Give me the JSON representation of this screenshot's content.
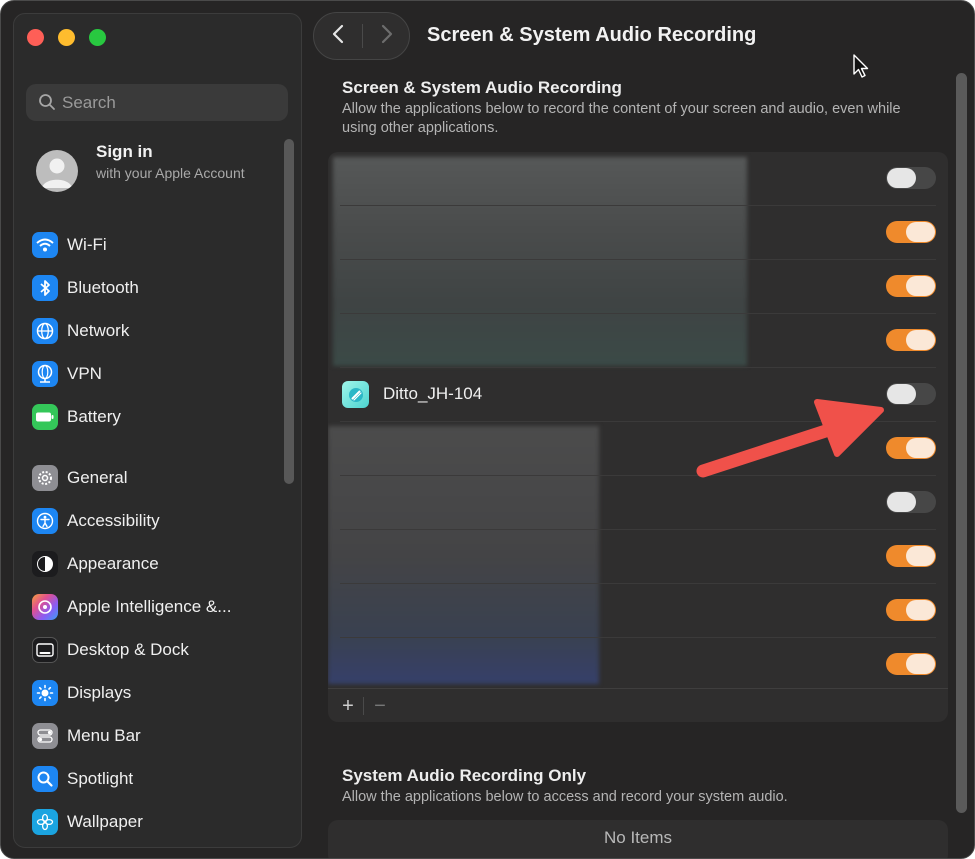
{
  "window": {
    "title": "Screen & System Audio Recording"
  },
  "search": {
    "placeholder": "Search"
  },
  "account": {
    "name": "Sign in",
    "subtitle": "with your Apple Account"
  },
  "sidebar": {
    "items": [
      {
        "label": "Wi-Fi",
        "icon": "wifi-icon",
        "color": "#1d86f2"
      },
      {
        "label": "Bluetooth",
        "icon": "bluetooth-icon",
        "color": "#1d86f2"
      },
      {
        "label": "Network",
        "icon": "globe-icon",
        "color": "#1d86f2"
      },
      {
        "label": "VPN",
        "icon": "vpn-globe-icon",
        "color": "#1d86f2"
      },
      {
        "label": "Battery",
        "icon": "battery-icon",
        "color": "#34c759"
      },
      {
        "label": "General",
        "icon": "gear-icon",
        "color": "#8e8e93"
      },
      {
        "label": "Accessibility",
        "icon": "accessibility-icon",
        "color": "#1d86f2"
      },
      {
        "label": "Appearance",
        "icon": "appearance-icon",
        "color": "#1c1c1e"
      },
      {
        "label": "Apple Intelligence &...",
        "icon": "apple-intelligence-icon",
        "color": "#c86dd7"
      },
      {
        "label": "Desktop & Dock",
        "icon": "dock-icon",
        "color": "#1c1c1e"
      },
      {
        "label": "Displays",
        "icon": "sun-icon",
        "color": "#1d86f2"
      },
      {
        "label": "Menu Bar",
        "icon": "menubar-toggle-icon",
        "color": "#8e8e93"
      },
      {
        "label": "Spotlight",
        "icon": "magnifier-icon",
        "color": "#1d86f2"
      },
      {
        "label": "Wallpaper",
        "icon": "flower-icon",
        "color": "#1ba4e0"
      }
    ]
  },
  "section1": {
    "title": "Screen & System Audio Recording",
    "description": "Allow the applications below to record the content of your screen and audio, even while using other applications."
  },
  "apps": [
    {
      "name": "",
      "enabled": false
    },
    {
      "name": "",
      "enabled": true
    },
    {
      "name": "",
      "enabled": true
    },
    {
      "name": "",
      "enabled": true
    },
    {
      "name": "Ditto_JH-104",
      "enabled": false
    },
    {
      "name": "",
      "enabled": true
    },
    {
      "name": "",
      "enabled": false
    },
    {
      "name": "",
      "enabled": true
    },
    {
      "name": "",
      "enabled": true
    },
    {
      "name": "",
      "enabled": true
    }
  ],
  "list_footer": {
    "add": "+",
    "remove": "−"
  },
  "section2": {
    "title": "System Audio Recording Only",
    "description": "Allow the applications below to access and record your system audio.",
    "empty_text": "No Items"
  },
  "colors": {
    "accent": "#ef8a2c",
    "annotation_arrow": "#f0514a"
  }
}
